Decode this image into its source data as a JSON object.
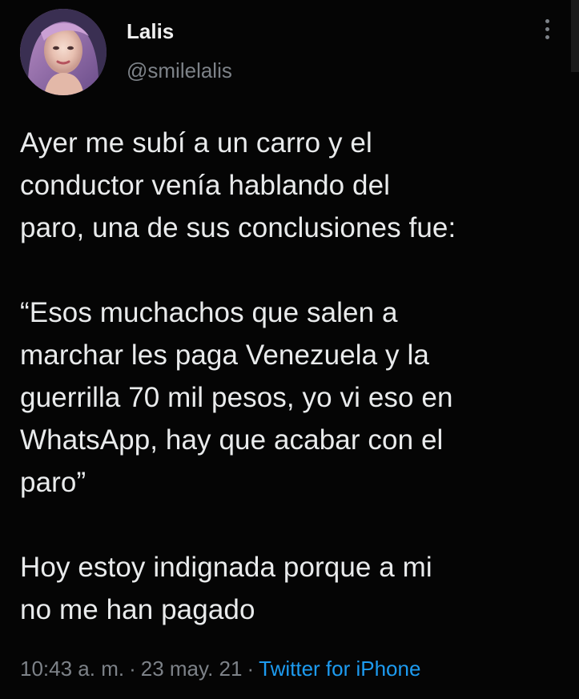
{
  "author": {
    "name": "Lalis",
    "handle": "@smilelalis"
  },
  "tweet": {
    "paragraphs": [
      [
        "Ayer me subí a un carro y el",
        "conductor venía hablando del",
        "paro, una de sus conclusiones fue:"
      ],
      [
        "“Esos muchachos que salen a",
        "marchar les paga Venezuela y la",
        "guerrilla 70 mil pesos, yo vi eso en",
        "WhatsApp, hay que acabar con el",
        "paro”"
      ],
      [
        "Hoy estoy indignada porque a mi",
        "no me han pagado"
      ]
    ]
  },
  "meta": {
    "time": "10:43 a. m.",
    "separator": "·",
    "date": "23 may. 21",
    "source": "Twitter for iPhone"
  },
  "icons": {
    "more": "more-vertical-icon",
    "avatar": "profile-photo"
  },
  "colors": {
    "background": "#050505",
    "text": "#e9ebec",
    "secondary": "#7d8288",
    "link": "#1d9bf0"
  }
}
